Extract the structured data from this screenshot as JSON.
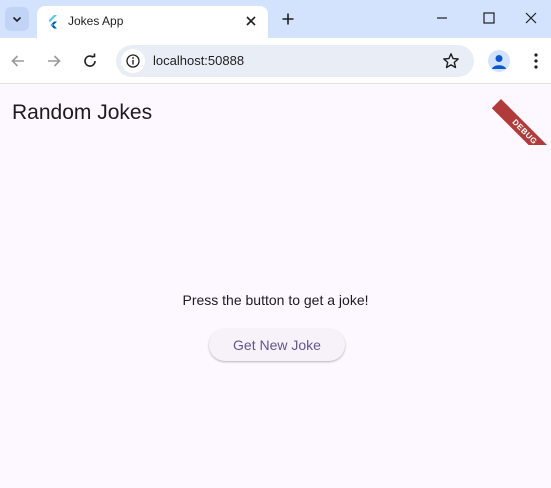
{
  "browser": {
    "tab_title": "Jokes App",
    "url": "localhost:50888",
    "favicon": "flutter-icon",
    "colors": {
      "tabstrip": "#d3e3fd",
      "omnibox": "#e9eef6"
    }
  },
  "app": {
    "title": "Random Jokes",
    "joke_text": "Press the button to get a joke!",
    "button_label": "Get New Joke",
    "debug_label": "DEBUG",
    "colors": {
      "background": "#fdf7ff",
      "button_text": "#65558f",
      "debug_banner": "#b13a3a"
    }
  }
}
